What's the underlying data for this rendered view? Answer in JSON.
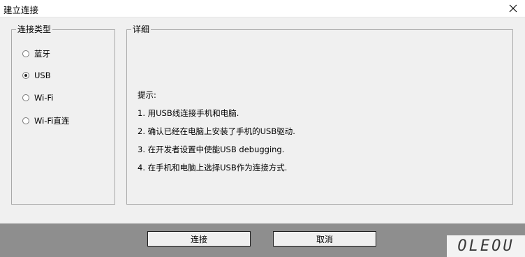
{
  "window": {
    "title": "建立连接",
    "close_icon": "close-icon"
  },
  "connection_type": {
    "legend": "连接类型",
    "options": [
      {
        "label": "蓝牙",
        "checked": false
      },
      {
        "label": "USB",
        "checked": true
      },
      {
        "label": "Wi-Fi",
        "checked": false
      },
      {
        "label": "Wi-Fi直连",
        "checked": false
      }
    ]
  },
  "details": {
    "legend": "详细",
    "tips_heading": "提示:",
    "tips": [
      "1. 用USB线连接手机和电脑.",
      "2. 确认已经在电脑上安装了手机的USB驱动.",
      "3. 在开发者设置中使能USB debugging.",
      "4. 在手机和电脑上选择USB作为连接方式."
    ]
  },
  "buttons": {
    "connect": "连接",
    "cancel": "取消"
  },
  "watermark": "OLEOU"
}
